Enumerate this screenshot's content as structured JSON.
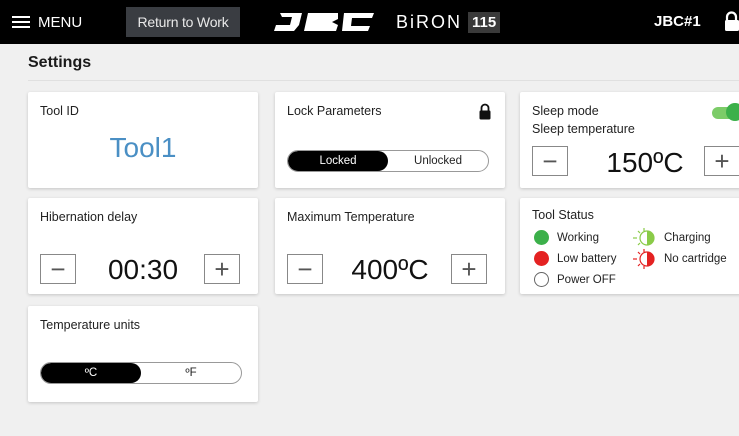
{
  "topbar": {
    "menu_label": "MENU",
    "return_label": "Return to Work",
    "brand": "JBC",
    "model_name": "BiRON",
    "model_number": "115",
    "station": "JBC#1"
  },
  "page": {
    "title": "Settings"
  },
  "tool_id": {
    "label": "Tool ID",
    "value": "Tool1"
  },
  "lock_parameters": {
    "label": "Lock Parameters",
    "options": [
      "Locked",
      "Unlocked"
    ],
    "selected": "Locked"
  },
  "sleep": {
    "label": "Sleep mode",
    "temp_label": "Sleep temperature",
    "enabled": true,
    "value": "150ºC",
    "minus": "−",
    "plus": "+"
  },
  "hibernation": {
    "label": "Hibernation delay",
    "value": "00:30",
    "minus": "−",
    "plus": "+"
  },
  "max_temp": {
    "label": "Maximum Temperature",
    "value": "400ºC",
    "minus": "−",
    "plus": "+"
  },
  "tool_status": {
    "label": "Tool Status",
    "items": [
      {
        "label": "Working",
        "color": "#3cb04a"
      },
      {
        "label": "Low battery",
        "color": "#e42222"
      },
      {
        "label": "Power OFF",
        "color": "#ffffff"
      },
      {
        "label": "Charging",
        "color": "#8acb48"
      },
      {
        "label": "No cartridge",
        "color": "#e42222"
      }
    ]
  },
  "temp_units": {
    "label": "Temperature units",
    "options": [
      "ºC",
      "ºF"
    ],
    "selected": "ºC"
  },
  "colors": {
    "accent_blue": "#4a8fc4",
    "green": "#3cb04a",
    "red": "#e42222",
    "topbar": "#000000"
  }
}
